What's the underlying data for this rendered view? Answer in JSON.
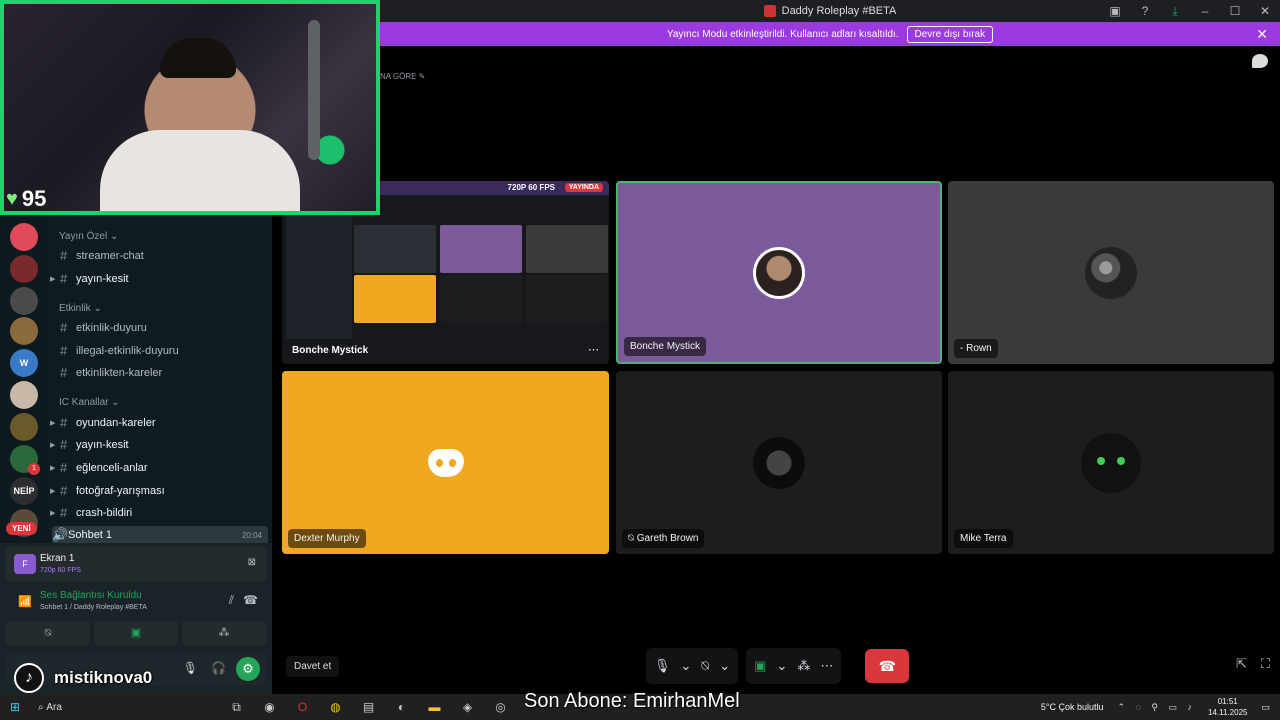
{
  "titlebar": {
    "title": "Daddy Roleplay #BETA"
  },
  "banner": {
    "message": "Yayıncı Modu etkinleştirildi. Kullanıcı adları kısaltıldı.",
    "disable_button": "Devre dışı bırak",
    "close_glyph": "✕"
  },
  "topic_text": "NA GÖRE ✎",
  "webcam": {
    "heart_count": "95"
  },
  "server_rail": {
    "neip_label": "NEİP",
    "new_badge": "YENİ",
    "unread_count": "1"
  },
  "channels": {
    "categories": [
      "Yayın Özel",
      "Etkinlik",
      "IC Kanallar"
    ],
    "items": [
      "streamer-chat",
      "yayın-kesit",
      "etkinlik-duyuru",
      "illegal-etkinlik-duyuru",
      "etkinlikten-kareler",
      "oyundan-kareler",
      "yayın-kesit",
      "eğlenceli-anlar",
      "fotoğraf-yarışması",
      "crash-bildiri"
    ],
    "voice_channel": {
      "name": "Sohbet 1",
      "time": "20:04"
    }
  },
  "screen_share": {
    "title": "Ekran 1",
    "quality": "720p 60 FPS"
  },
  "voice_status": {
    "title": "Ses Bağlantısı Kuruldu",
    "subtitle": "Sohbet 1 / Daddy Roleplay #BETA"
  },
  "overlay": {
    "tiktok_name": "mistiknova0",
    "subscriber_text": "Son Abone: EmirhanMel"
  },
  "tiles": {
    "screen": {
      "name": "Bonche Mystick",
      "fps": "720P 60 FPS",
      "live": "YAYINDA"
    },
    "bonche": {
      "name": "Bonche Mystick"
    },
    "rown": {
      "name": "- Rown"
    },
    "dexter": {
      "name": "Dexter Murphy"
    },
    "gareth": {
      "name": "Gareth Brown"
    },
    "mike": {
      "name": "Mike Terra"
    }
  },
  "call": {
    "invite": "Davet et"
  },
  "taskbar": {
    "search_placeholder": "Ara",
    "weather": "5°C  Çok bulutlu",
    "time": "01:51",
    "date": "14.11.2025"
  },
  "colors": {
    "accent_purple": "#9b3ae0",
    "online_green": "#23a55a",
    "danger_red": "#da373c",
    "discord_orange": "#f0a820"
  }
}
